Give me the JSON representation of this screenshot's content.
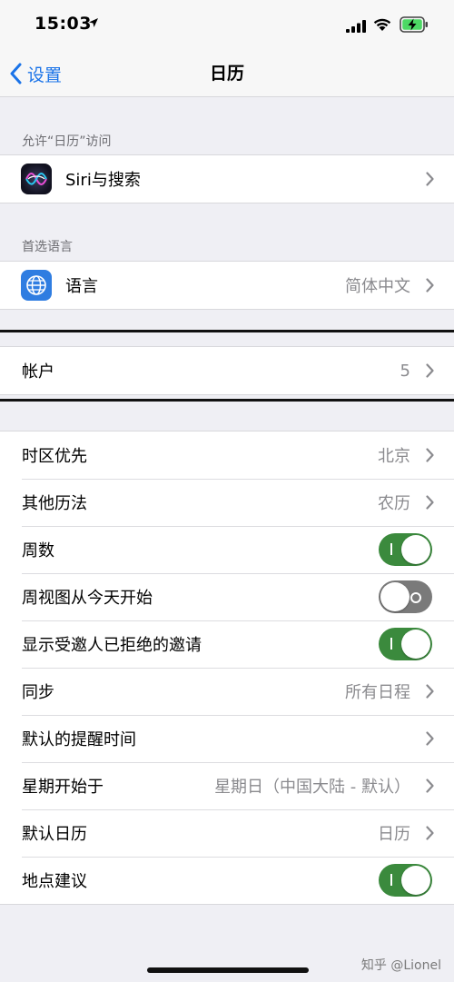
{
  "status": {
    "time": "15:03"
  },
  "nav": {
    "back_label": "设置",
    "title": "日历"
  },
  "sections": {
    "access_header": "允许“日历”访问",
    "siri_label": "Siri与搜索",
    "lang_header": "首选语言",
    "lang_label": "语言",
    "lang_value": "简体中文",
    "accounts_label": "帐户",
    "accounts_value": "5"
  },
  "settings": {
    "timezone_label": "时区优先",
    "timezone_value": "北京",
    "alt_calendar_label": "其他历法",
    "alt_calendar_value": "农历",
    "week_numbers_label": "周数",
    "week_numbers_on": true,
    "week_view_today_label": "周视图从今天开始",
    "week_view_today_on": false,
    "show_declined_label": "显示受邀人已拒绝的邀请",
    "show_declined_on": true,
    "sync_label": "同步",
    "sync_value": "所有日程",
    "default_alert_label": "默认的提醒时间",
    "start_week_label": "星期开始于",
    "start_week_value": "星期日（中国大陆 - 默认）",
    "default_calendar_label": "默认日历",
    "default_calendar_value": "日历",
    "location_suggest_label": "地点建议",
    "location_suggest_on": true
  },
  "watermark": "知乎 @Lionel",
  "colors": {
    "accent": "#1a73e8",
    "toggle_on": "#3b8a3d",
    "toggle_off": "#7a7a7a",
    "background": "#efeff4"
  }
}
